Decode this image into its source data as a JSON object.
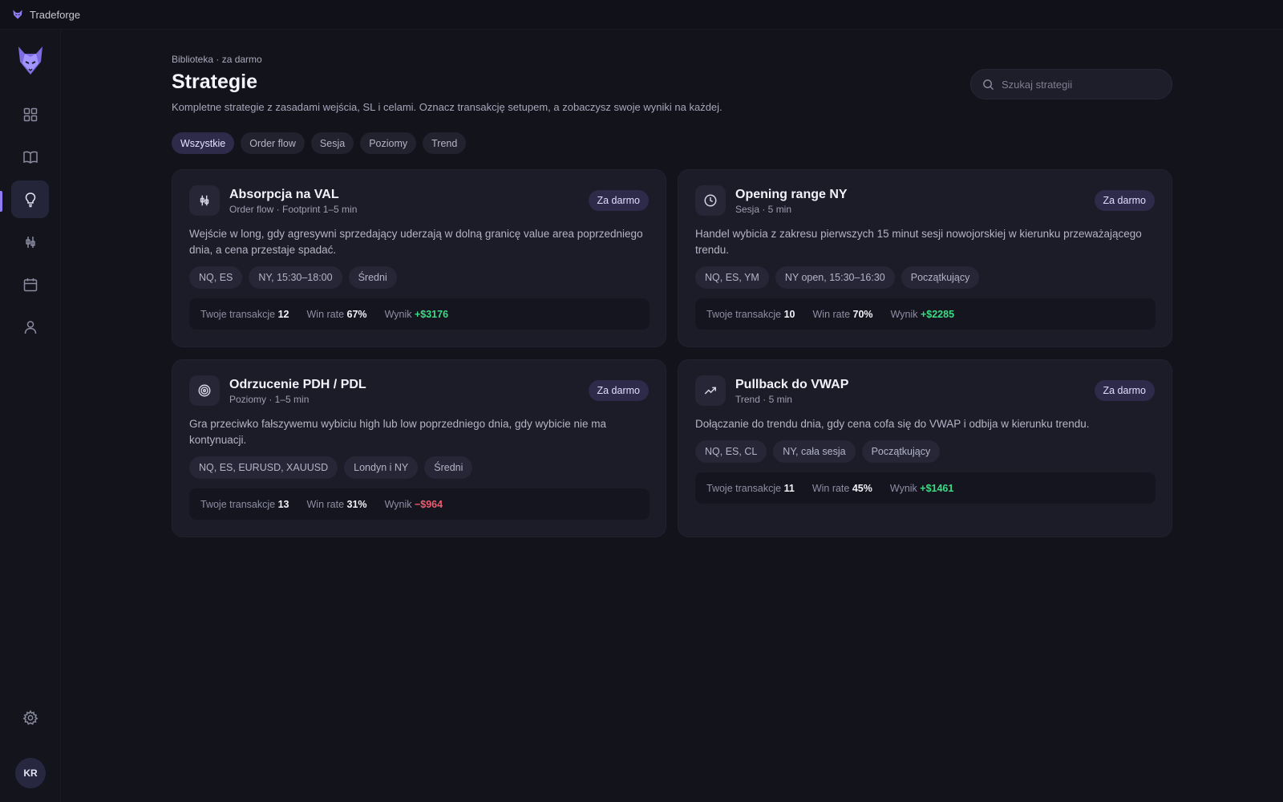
{
  "app": {
    "title": "Tradeforge"
  },
  "user": {
    "initials": "KR"
  },
  "header": {
    "breadcrumb": "Biblioteka · za darmo",
    "title": "Strategie",
    "description": "Kompletne strategie z zasadami wejścia, SL i celami. Oznacz transakcję setupem, a zobaczysz swoje wyniki na każdej.",
    "search_placeholder": "Szukaj strategii"
  },
  "nav": [
    "dashboard",
    "journal",
    "strategies",
    "charts",
    "calendar",
    "profile",
    "settings"
  ],
  "filters": [
    "Wszystkie",
    "Order flow",
    "Sesja",
    "Poziomy",
    "Trend"
  ],
  "active_filter": "Wszystkie",
  "stat_labels": {
    "trades": "Twoje transakcje",
    "winrate": "Win rate",
    "result": "Wynik"
  },
  "colors": {
    "accent": "#8f7cf2",
    "positive": "#3ddc84",
    "negative": "#f05b6e"
  },
  "cards": [
    {
      "icon": "candlestick-icon",
      "title": "Absorpcja na VAL",
      "subtitle": "Order flow · Footprint 1–5 min",
      "badge": "Za darmo",
      "description": "Wejście w long, gdy agresywni sprzedający uderzają w dolną granicę value area poprzedniego dnia, a cena przestaje spadać.",
      "tags": [
        "NQ, ES",
        "NY, 15:30–18:00",
        "Średni"
      ],
      "trades": "12",
      "winrate": "67%",
      "result": "+$3176"
    },
    {
      "icon": "clock-icon",
      "title": "Opening range NY",
      "subtitle": "Sesja · 5 min",
      "badge": "Za darmo",
      "description": "Handel wybicia z zakresu pierwszych 15 minut sesji nowojorskiej w kierunku przeważającego trendu.",
      "tags": [
        "NQ, ES, YM",
        "NY open, 15:30–16:30",
        "Początkujący"
      ],
      "trades": "10",
      "winrate": "70%",
      "result": "+$2285"
    },
    {
      "icon": "target-icon",
      "title": "Odrzucenie PDH / PDL",
      "subtitle": "Poziomy · 1–5 min",
      "badge": "Za darmo",
      "description": "Gra przeciwko fałszywemu wybiciu high lub low poprzedniego dnia, gdy wybicie nie ma kontynuacji.",
      "tags": [
        "NQ, ES, EURUSD, XAUUSD",
        "Londyn i NY",
        "Średni"
      ],
      "trades": "13",
      "winrate": "31%",
      "result": "−$964"
    },
    {
      "icon": "trending-up-icon",
      "title": "Pullback do VWAP",
      "subtitle": "Trend · 5 min",
      "badge": "Za darmo",
      "description": "Dołączanie do trendu dnia, gdy cena cofa się do VWAP i odbija w kierunku trendu.",
      "tags": [
        "NQ, ES, CL",
        "NY, cała sesja",
        "Początkujący"
      ],
      "trades": "11",
      "winrate": "45%",
      "result": "+$1461"
    }
  ]
}
